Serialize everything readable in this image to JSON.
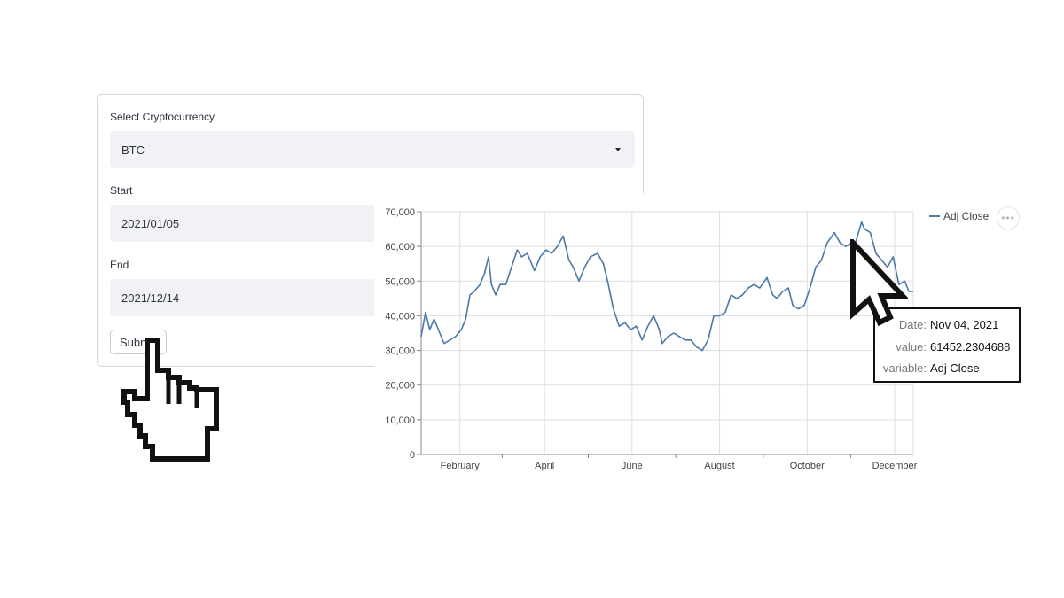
{
  "form": {
    "crypto_label": "Select Cryptocurrency",
    "crypto_value": "BTC",
    "start_label": "Start",
    "start_value": "2021/01/05",
    "end_label": "End",
    "end_value": "2021/12/14",
    "submit_label": "Submit"
  },
  "tooltip": {
    "date_key": "Date:",
    "date_value": "Nov 04, 2021",
    "value_key": "value:",
    "value_value": "61452.2304688",
    "variable_key": "variable:",
    "variable_value": "Adj Close"
  },
  "more_icon": "more-horizontal-icon",
  "colors": {
    "line": "#4c78a8",
    "grid": "#dddddd",
    "field_bg": "#f0f2f6"
  },
  "chart_data": {
    "type": "line",
    "xlabel": "",
    "ylabel": "",
    "ylim": [
      0,
      70000
    ],
    "yticks": [
      0,
      10000,
      20000,
      30000,
      40000,
      50000,
      60000,
      70000
    ],
    "ytick_labels": [
      "0",
      "10,000",
      "20,000",
      "30,000",
      "40,000",
      "50,000",
      "60,000",
      "70,000"
    ],
    "xticks": [
      "2021-02-01",
      "2021-04-01",
      "2021-06-01",
      "2021-08-01",
      "2021-10-01",
      "2021-12-01"
    ],
    "xtick_labels": [
      "February",
      "April",
      "June",
      "August",
      "October",
      "December"
    ],
    "xlim": [
      "2021-01-05",
      "2021-12-14"
    ],
    "grid": true,
    "legend": "top-right",
    "series": [
      {
        "name": "Adj Close",
        "x": [
          "2021-01-05",
          "2021-01-08",
          "2021-01-11",
          "2021-01-14",
          "2021-01-18",
          "2021-01-21",
          "2021-01-25",
          "2021-01-29",
          "2021-02-02",
          "2021-02-05",
          "2021-02-08",
          "2021-02-11",
          "2021-02-15",
          "2021-02-18",
          "2021-02-21",
          "2021-02-23",
          "2021-02-26",
          "2021-03-01",
          "2021-03-05",
          "2021-03-09",
          "2021-03-13",
          "2021-03-16",
          "2021-03-20",
          "2021-03-25",
          "2021-03-29",
          "2021-04-02",
          "2021-04-06",
          "2021-04-10",
          "2021-04-14",
          "2021-04-18",
          "2021-04-21",
          "2021-04-25",
          "2021-04-29",
          "2021-05-03",
          "2021-05-08",
          "2021-05-12",
          "2021-05-15",
          "2021-05-19",
          "2021-05-23",
          "2021-05-27",
          "2021-05-31",
          "2021-06-04",
          "2021-06-08",
          "2021-06-12",
          "2021-06-16",
          "2021-06-20",
          "2021-06-22",
          "2021-06-26",
          "2021-06-30",
          "2021-07-04",
          "2021-07-08",
          "2021-07-12",
          "2021-07-16",
          "2021-07-20",
          "2021-07-24",
          "2021-07-28",
          "2021-08-01",
          "2021-08-05",
          "2021-08-09",
          "2021-08-13",
          "2021-08-17",
          "2021-08-21",
          "2021-08-25",
          "2021-08-29",
          "2021-09-03",
          "2021-09-07",
          "2021-09-10",
          "2021-09-14",
          "2021-09-18",
          "2021-09-21",
          "2021-09-25",
          "2021-09-29",
          "2021-10-03",
          "2021-10-07",
          "2021-10-11",
          "2021-10-15",
          "2021-10-20",
          "2021-10-24",
          "2021-10-28",
          "2021-11-01",
          "2021-11-04",
          "2021-11-08",
          "2021-11-10",
          "2021-11-14",
          "2021-11-18",
          "2021-11-22",
          "2021-11-26",
          "2021-11-30",
          "2021-12-04",
          "2021-12-08",
          "2021-12-11",
          "2021-12-14"
        ],
        "values": [
          34000,
          41000,
          36000,
          39000,
          35000,
          32000,
          33000,
          34000,
          36000,
          39000,
          46000,
          47000,
          49000,
          52000,
          57000,
          49000,
          46000,
          49000,
          49000,
          54000,
          59000,
          57000,
          58000,
          53000,
          57000,
          59000,
          58000,
          60000,
          63000,
          56000,
          54000,
          50000,
          54000,
          57000,
          58000,
          55000,
          50000,
          42000,
          37000,
          38000,
          36000,
          37000,
          33000,
          37000,
          40000,
          36000,
          32000,
          34000,
          35000,
          34000,
          33000,
          33000,
          31000,
          30000,
          33000,
          40000,
          40000,
          41000,
          46000,
          45000,
          46000,
          48000,
          49000,
          48000,
          51000,
          46000,
          45000,
          47000,
          48000,
          43000,
          42000,
          43000,
          48000,
          54000,
          56000,
          61000,
          64000,
          61000,
          60000,
          61000,
          61452,
          67000,
          65000,
          64000,
          58000,
          56000,
          54000,
          57000,
          49000,
          50000,
          47000,
          47000
        ]
      }
    ]
  }
}
